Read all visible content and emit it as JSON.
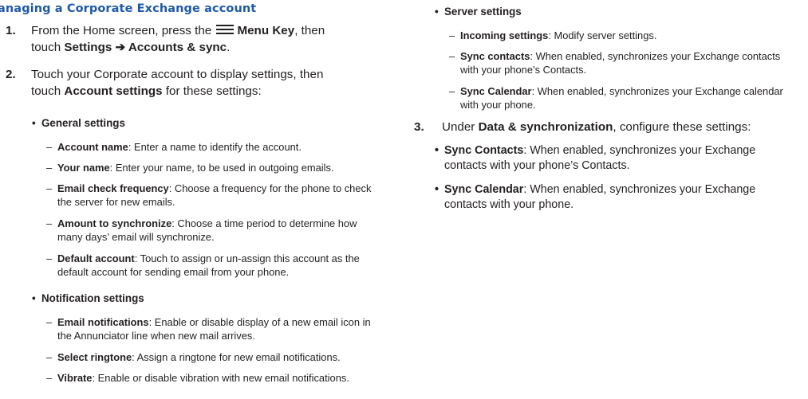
{
  "heading": "anaging a Corporate Exchange account",
  "steps": [
    {
      "num": "1.",
      "line1_before": "From the Home screen, press the",
      "menu_key_label": "Menu Key",
      "line1_after": ", then",
      "line2_before": "touch ",
      "path": "Settings ➔ Accounts & sync",
      "line2_after": "."
    },
    {
      "num": "2.",
      "line1": "Touch your Corporate account to display settings, then",
      "line2_before": "touch ",
      "bold": "Account settings",
      "line2_after": " for these settings:"
    },
    {
      "num": "3.",
      "before": "Under ",
      "bold": "Data & synchronization",
      "after": ", configure these settings:"
    }
  ],
  "bullet_char": "•",
  "dash_char": "–",
  "general": {
    "title": "General settings",
    "items": [
      {
        "term": "Account name",
        "line1": ": Enter a name to identify the account."
      },
      {
        "term": "Your name",
        "line1": ": Enter your name, to be used in outgoing emails."
      },
      {
        "term": "Email check frequency",
        "line1": ": Choose a frequency for the phone to check",
        "line2": "the server for new emails."
      },
      {
        "term": "Amount to synchronize",
        "line1": ": Choose a time period to determine how",
        "line2": "many days’ email will synchronize."
      },
      {
        "term": "Default account",
        "line1": ": Touch to assign or un-assign this account as the",
        "line2": "default account for sending email from your phone."
      }
    ]
  },
  "notification": {
    "title": "Notification settings",
    "items": [
      {
        "term": "Email notifications",
        "line1": ": Enable or disable display of a new email icon in",
        "line2": "the Annunciator line when new mail arrives."
      },
      {
        "term": "Select ringtone",
        "line1": ": Assign a ringtone for new email notifications."
      },
      {
        "term": "Vibrate",
        "line1": ": Enable or disable vibration with new email notifications."
      }
    ]
  },
  "server": {
    "title": "Server settings",
    "items": [
      {
        "term": "Incoming settings",
        "line1": ": Modify server settings."
      },
      {
        "term": "Sync contacts",
        "line1": ": When enabled, synchronizes your Exchange contacts",
        "line2": "with your phone’s Contacts."
      },
      {
        "term": "Sync Calendar",
        "line1": ": When enabled, synchronizes your Exchange calendar",
        "line2": "with your phone."
      }
    ]
  },
  "data_sync": {
    "items": [
      {
        "term": "Sync Contacts",
        "line1": ": When enabled, synchronizes your Exchange",
        "line2": "contacts with your phone’s Contacts."
      },
      {
        "term": "Sync Calendar",
        "line1": ": When enabled, synchronizes your Exchange",
        "line2": "contacts with your phone."
      }
    ]
  }
}
